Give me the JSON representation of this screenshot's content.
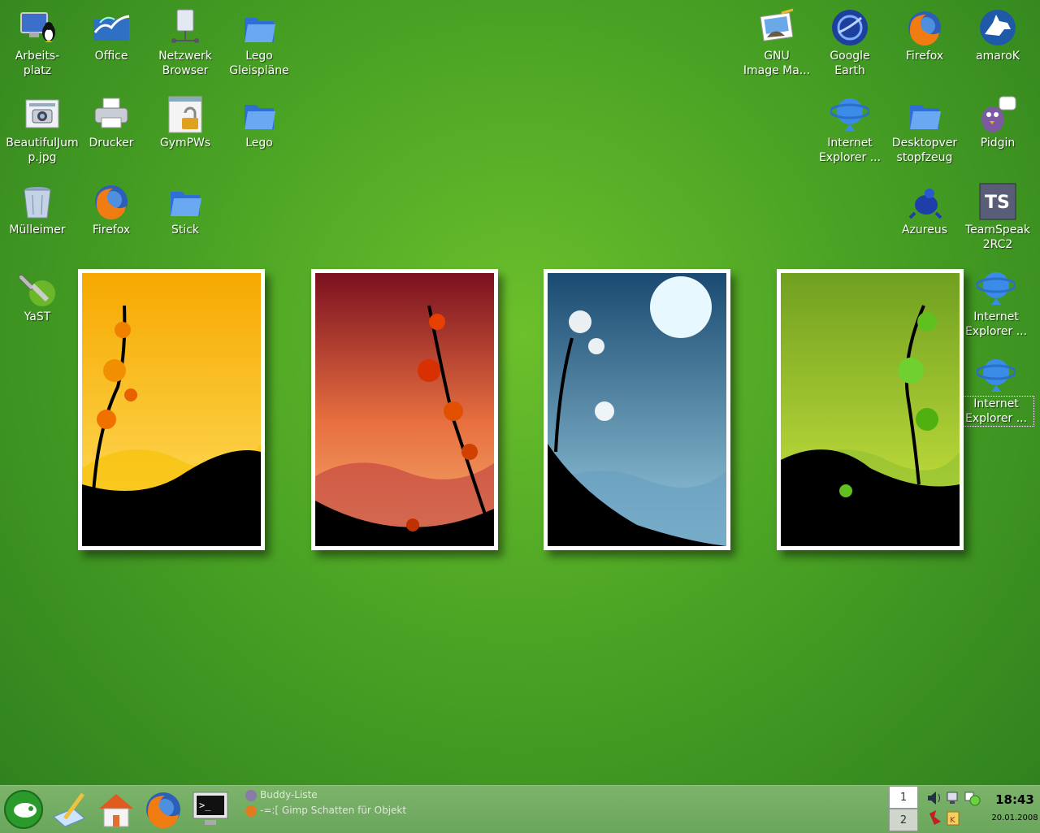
{
  "desktop": {
    "icons": [
      {
        "label": "Arbeits-\nplatz"
      },
      {
        "label": "Office"
      },
      {
        "label": "Netzwerk\nBrowser"
      },
      {
        "label": "Lego\nGleispläne"
      },
      {
        "label": "BeautifulJum\np.jpg"
      },
      {
        "label": "Drucker"
      },
      {
        "label": "GymPWs"
      },
      {
        "label": "Lego"
      },
      {
        "label": "Mülleimer"
      },
      {
        "label": "Firefox"
      },
      {
        "label": "Stick"
      },
      {
        "label": "YaST"
      },
      {
        "label": "GNU\nImage Ma..."
      },
      {
        "label": "Google\nEarth"
      },
      {
        "label": "Firefox"
      },
      {
        "label": "amaroK"
      },
      {
        "label": "Internet\nExplorer ..."
      },
      {
        "label": "Desktopver\nstopfzeug"
      },
      {
        "label": "Pidgin"
      },
      {
        "label": "Azureus"
      },
      {
        "label": "TeamSpeak\n2RC2"
      },
      {
        "label": "Internet\nExplorer ..."
      },
      {
        "label": "Internet\nExplorer ..."
      }
    ]
  },
  "taskbar": {
    "tasks": [
      {
        "label": "Buddy-Liste"
      },
      {
        "label": "-=:[ Gimp Schatten für Objekt"
      }
    ],
    "pager": [
      "1",
      "2"
    ],
    "clock": {
      "time": "18:43",
      "date": "20.01.2008"
    }
  },
  "colors": {
    "desktop_green": "#4aa324",
    "taskbar": "#74ad64"
  }
}
